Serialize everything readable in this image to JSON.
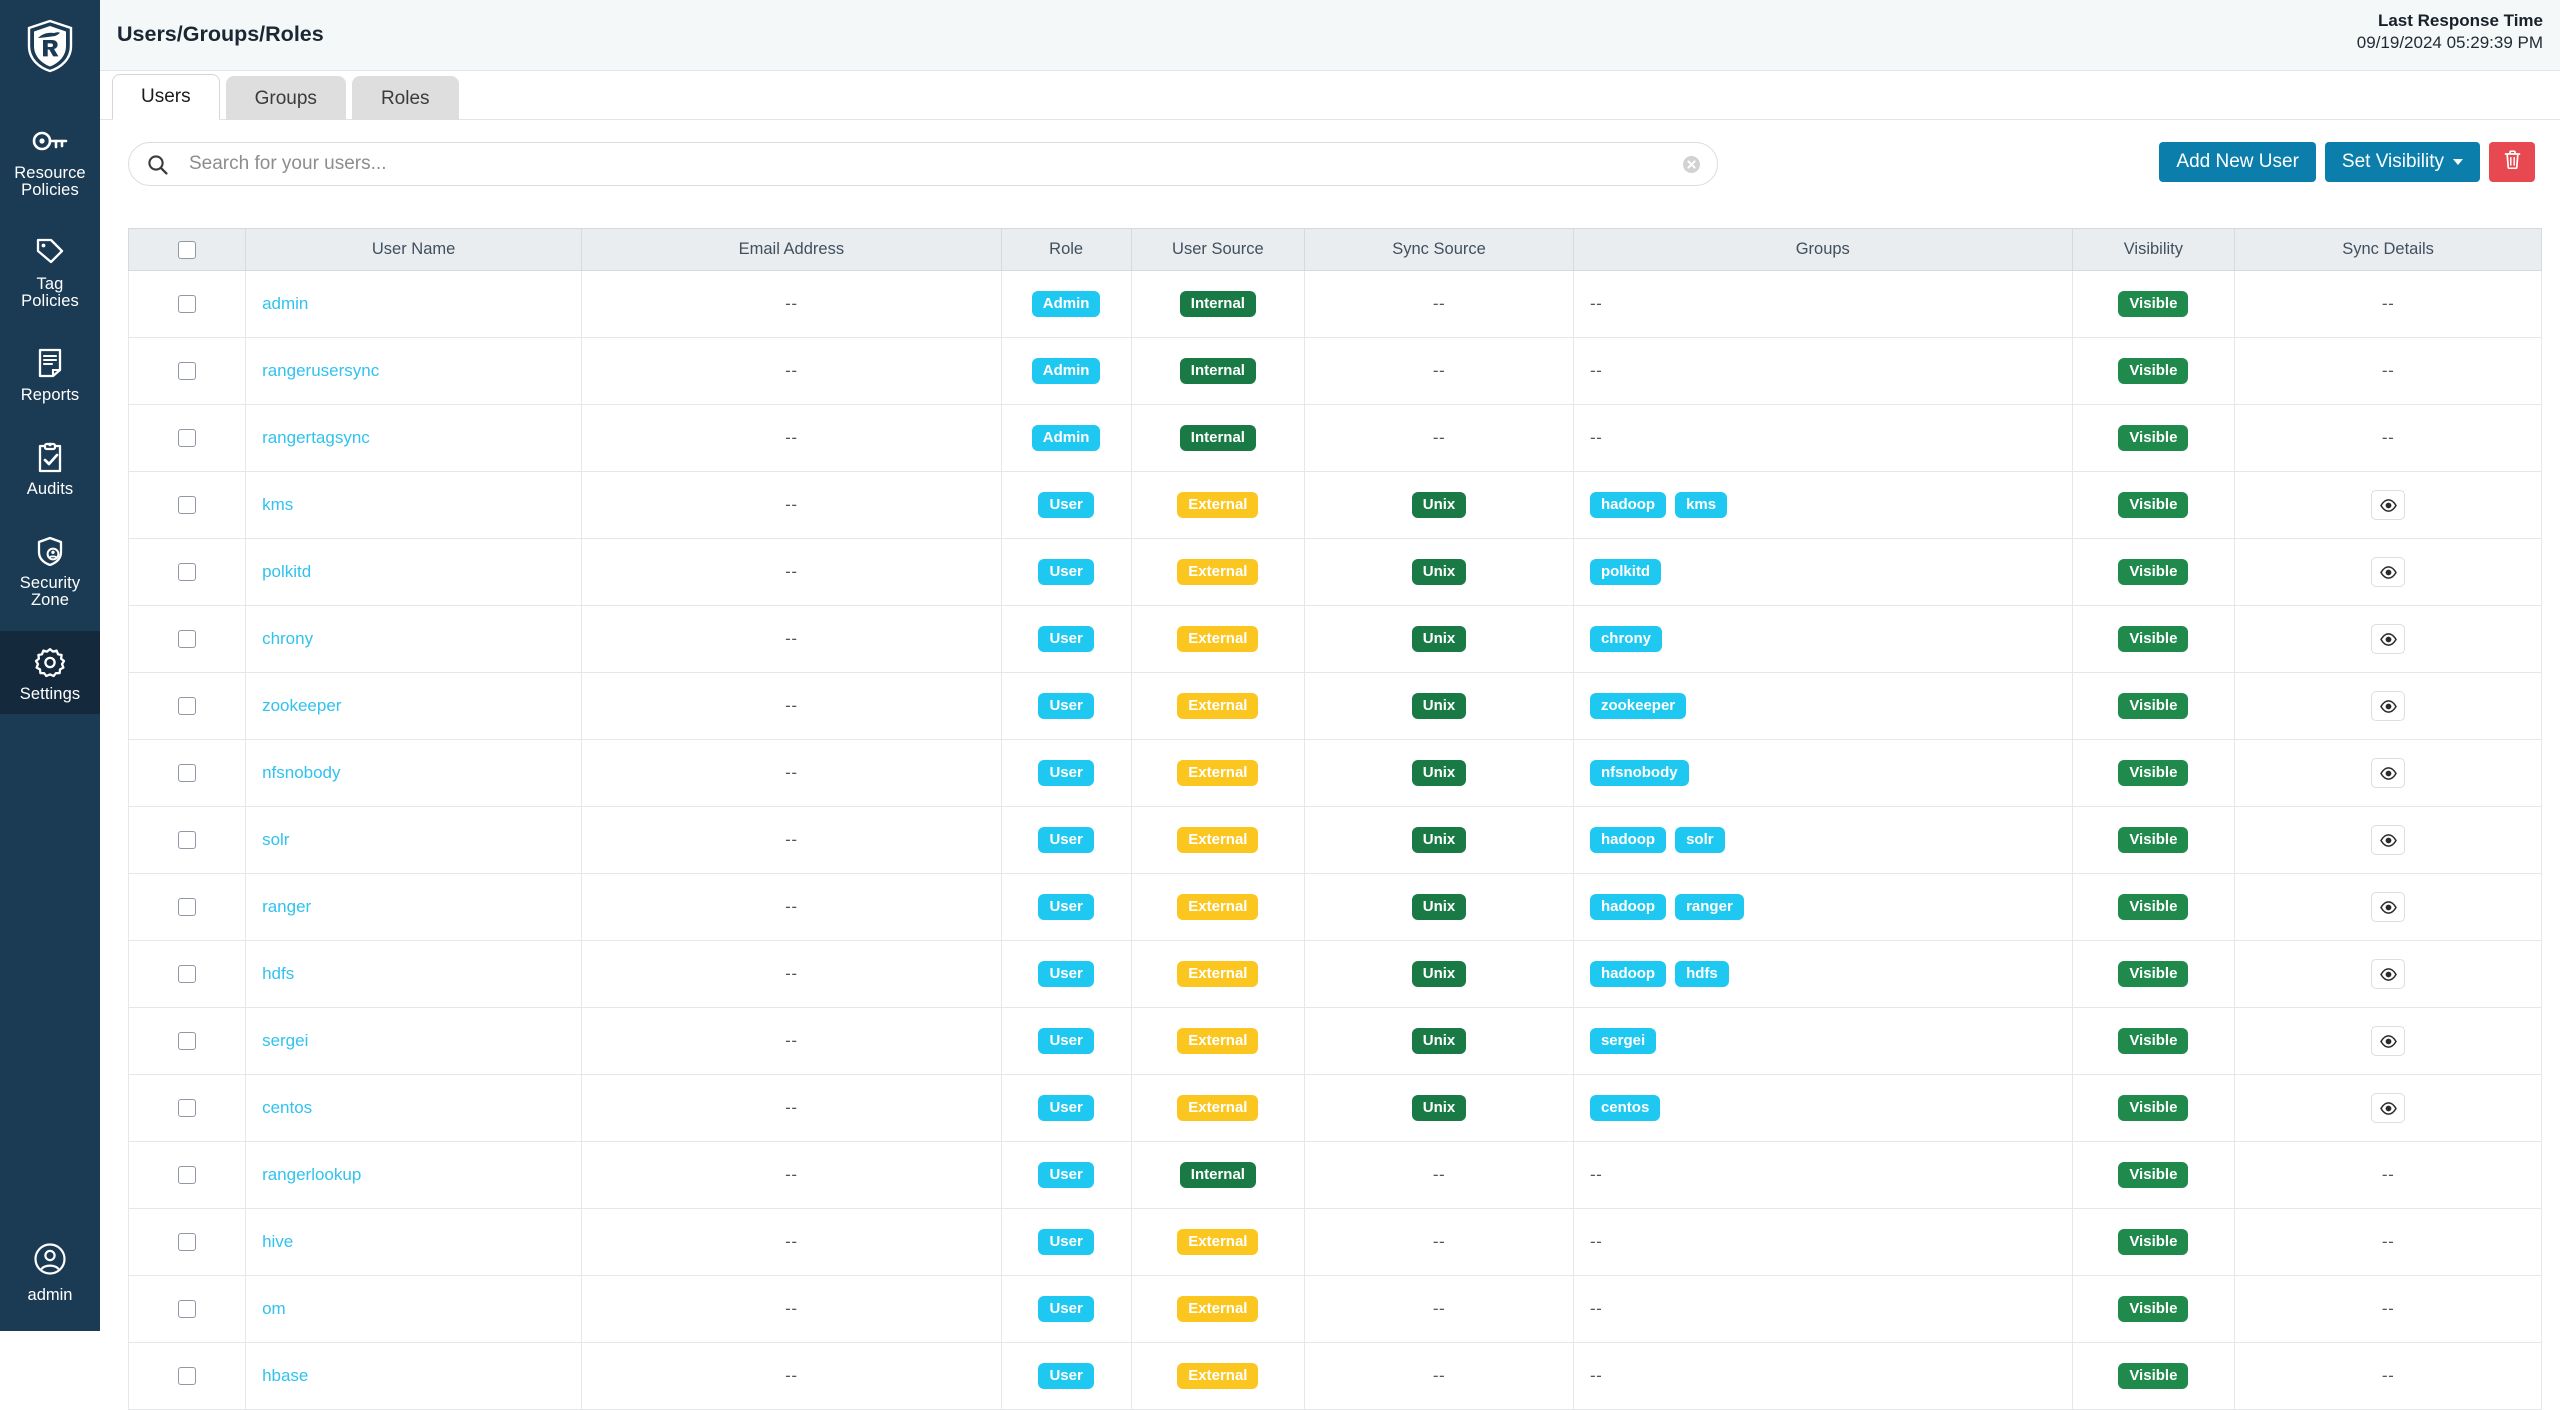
{
  "sidebar": {
    "logo_alt": "Apache Ranger shield logo",
    "items": [
      {
        "label": "Resource\nPolicies",
        "label_lines": [
          "Resource",
          "Policies"
        ],
        "icon": "key-icon",
        "active": false
      },
      {
        "label": "Tag\nPolicies",
        "label_lines": [
          "Tag",
          "Policies"
        ],
        "icon": "tag-icon",
        "active": false
      },
      {
        "label": "Reports",
        "label_lines": [
          "Reports"
        ],
        "icon": "report-icon",
        "active": false
      },
      {
        "label": "Audits",
        "label_lines": [
          "Audits"
        ],
        "icon": "clipboard-check-icon",
        "active": false
      },
      {
        "label": "Security\nZone",
        "label_lines": [
          "Security",
          "Zone"
        ],
        "icon": "shield-user-icon",
        "active": false
      },
      {
        "label": "Settings",
        "label_lines": [
          "Settings"
        ],
        "icon": "gear-icon",
        "active": true
      }
    ],
    "user": {
      "name": "admin",
      "icon": "user-circle-icon"
    }
  },
  "header": {
    "title": "Users/Groups/Roles",
    "last_response_label": "Last Response Time",
    "last_response_value": "09/19/2024 05:29:39 PM"
  },
  "tabs": [
    {
      "label": "Users",
      "active": true
    },
    {
      "label": "Groups",
      "active": false
    },
    {
      "label": "Roles",
      "active": false
    }
  ],
  "search": {
    "placeholder": "Search for your users...",
    "value": "",
    "icon": "search-icon",
    "clear_icon": "clear-circle-icon"
  },
  "toolbar": {
    "add_new_user": "Add New User",
    "set_visibility": "Set Visibility",
    "delete_icon": "trash-icon"
  },
  "table": {
    "columns": [
      "",
      "User Name",
      "Email Address",
      "Role",
      "User Source",
      "Sync Source",
      "Groups",
      "Visibility",
      "Sync Details"
    ],
    "rows": [
      {
        "user": "admin",
        "email": "--",
        "role": "Admin",
        "user_source": "Internal",
        "sync_source": "--",
        "groups": [],
        "visibility": "Visible",
        "sync_details": "--"
      },
      {
        "user": "rangerusersync",
        "email": "--",
        "role": "Admin",
        "user_source": "Internal",
        "sync_source": "--",
        "groups": [],
        "visibility": "Visible",
        "sync_details": "--"
      },
      {
        "user": "rangertagsync",
        "email": "--",
        "role": "Admin",
        "user_source": "Internal",
        "sync_source": "--",
        "groups": [],
        "visibility": "Visible",
        "sync_details": "--"
      },
      {
        "user": "kms",
        "email": "--",
        "role": "User",
        "user_source": "External",
        "sync_source": "Unix",
        "groups": [
          "hadoop",
          "kms"
        ],
        "visibility": "Visible",
        "sync_details": "eye"
      },
      {
        "user": "polkitd",
        "email": "--",
        "role": "User",
        "user_source": "External",
        "sync_source": "Unix",
        "groups": [
          "polkitd"
        ],
        "visibility": "Visible",
        "sync_details": "eye"
      },
      {
        "user": "chrony",
        "email": "--",
        "role": "User",
        "user_source": "External",
        "sync_source": "Unix",
        "groups": [
          "chrony"
        ],
        "visibility": "Visible",
        "sync_details": "eye"
      },
      {
        "user": "zookeeper",
        "email": "--",
        "role": "User",
        "user_source": "External",
        "sync_source": "Unix",
        "groups": [
          "zookeeper"
        ],
        "visibility": "Visible",
        "sync_details": "eye"
      },
      {
        "user": "nfsnobody",
        "email": "--",
        "role": "User",
        "user_source": "External",
        "sync_source": "Unix",
        "groups": [
          "nfsnobody"
        ],
        "visibility": "Visible",
        "sync_details": "eye"
      },
      {
        "user": "solr",
        "email": "--",
        "role": "User",
        "user_source": "External",
        "sync_source": "Unix",
        "groups": [
          "hadoop",
          "solr"
        ],
        "visibility": "Visible",
        "sync_details": "eye"
      },
      {
        "user": "ranger",
        "email": "--",
        "role": "User",
        "user_source": "External",
        "sync_source": "Unix",
        "groups": [
          "hadoop",
          "ranger"
        ],
        "visibility": "Visible",
        "sync_details": "eye"
      },
      {
        "user": "hdfs",
        "email": "--",
        "role": "User",
        "user_source": "External",
        "sync_source": "Unix",
        "groups": [
          "hadoop",
          "hdfs"
        ],
        "visibility": "Visible",
        "sync_details": "eye"
      },
      {
        "user": "sergei",
        "email": "--",
        "role": "User",
        "user_source": "External",
        "sync_source": "Unix",
        "groups": [
          "sergei"
        ],
        "visibility": "Visible",
        "sync_details": "eye"
      },
      {
        "user": "centos",
        "email": "--",
        "role": "User",
        "user_source": "External",
        "sync_source": "Unix",
        "groups": [
          "centos"
        ],
        "visibility": "Visible",
        "sync_details": "eye"
      },
      {
        "user": "rangerlookup",
        "email": "--",
        "role": "User",
        "user_source": "Internal",
        "sync_source": "--",
        "groups": [],
        "visibility": "Visible",
        "sync_details": "--"
      },
      {
        "user": "hive",
        "email": "--",
        "role": "User",
        "user_source": "External",
        "sync_source": "--",
        "groups": [],
        "visibility": "Visible",
        "sync_details": "--"
      },
      {
        "user": "om",
        "email": "--",
        "role": "User",
        "user_source": "External",
        "sync_source": "--",
        "groups": [],
        "visibility": "Visible",
        "sync_details": "--"
      },
      {
        "user": "hbase",
        "email": "--",
        "role": "User",
        "user_source": "External",
        "sync_source": "--",
        "groups": [],
        "visibility": "Visible",
        "sync_details": "--"
      }
    ]
  },
  "colors": {
    "sidebar_bg": "#1b3a54",
    "sidebar_active": "#14293c",
    "primary_button": "#0b7eab",
    "danger_button": "#e8484f",
    "badge_cyan": "#1fc8f0",
    "badge_green": "#1a7a45",
    "badge_amber": "#fcc620",
    "badge_visible_green": "#1f8a4c",
    "link_cyan": "#31c2ef",
    "table_header_bg": "#e9edf0",
    "topbar_bg": "#f4f8f8"
  }
}
